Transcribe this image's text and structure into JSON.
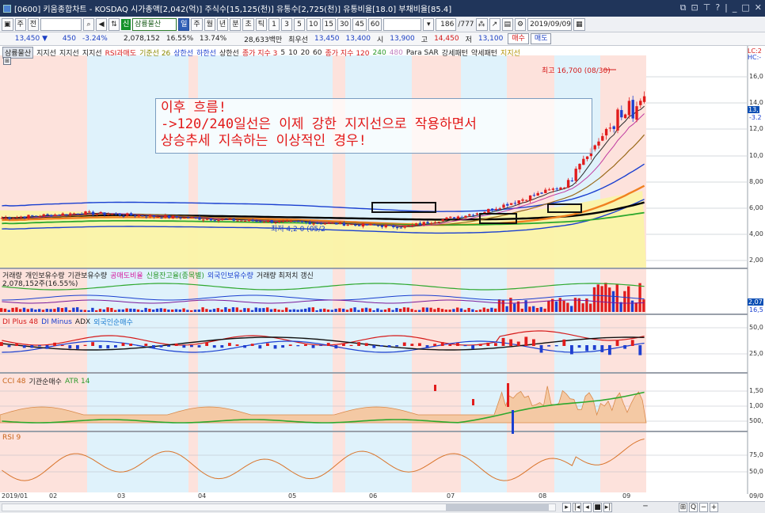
{
  "window": {
    "title": "[0600] 키움종합차트 - KOSDAQ 시가총액[2,042(억)] 주식수[15,125(천)] 유통수[2,725(천)] 유통비율[18.0] 부채비율[85.4]",
    "controls": [
      "⧉",
      "⊡",
      "⊤",
      "?",
      "|",
      "_",
      "□",
      "✕"
    ]
  },
  "toolbar1": {
    "mode_label": "주",
    "whole_label": "전",
    "code_value": "",
    "stock_badge": "신",
    "stock_name": "삼륭물산",
    "periods": [
      "일",
      "주",
      "월",
      "년",
      "분",
      "초",
      "틱"
    ],
    "selected_period": "일",
    "minutes": [
      "1",
      "3",
      "5",
      "10",
      "15",
      "30",
      "45",
      "60"
    ],
    "count_value": "186",
    "count_total": "/777",
    "date_value": "2019/09/09"
  },
  "quote": {
    "price": "13,450 ▼",
    "change": "450",
    "change_pct": "-3.24%",
    "volume": "2,078,152",
    "vol_pct": "16.55%",
    "turnover_pct": "13.74%",
    "amount": "28,633백만",
    "label_best": "최우선",
    "best_ask": "13,450",
    "best_bid": "13,400",
    "open_label": "시",
    "open": "13,900",
    "high_label": "고",
    "high": "14,450",
    "low_label": "저",
    "low": "13,100",
    "buy_label": "매수",
    "sell_label": "매도"
  },
  "legends": {
    "price": [
      "삼륭물산",
      "지지선",
      "지지선",
      "지지선",
      "RSI과매도",
      "기준선 26",
      "상한선",
      "하한선",
      "상한선",
      "종가 지수 3",
      "5",
      "10",
      "20",
      "60",
      "종가 지수 120",
      "240",
      "480",
      "Para SAR",
      "강세패턴",
      "약세패턴",
      "지지선"
    ],
    "volume": [
      "거래량",
      "개인보유수량",
      "기관보유수량",
      "공매도비율",
      "신용잔고율(종목별)",
      "외국인보유수량",
      "거래량 최저치 갱신"
    ],
    "volume_value": "2,078,152주(16.55%)",
    "dmi": [
      "DI Plus 48",
      "DI Minus",
      "ADX",
      "외국인순매수"
    ],
    "cci": [
      "CCI 48",
      "기관순매수",
      "ATR 14"
    ],
    "rsi": [
      "RSI 9"
    ]
  },
  "annotation": {
    "line1": "이후 흐름!",
    "line2": "->120/240일선은 이제 강한 지지선으로 작용하면서",
    "line3": "상승추세 지속하는 이상적인 경우!"
  },
  "price_marks": {
    "high_note": "최고 16,700 (08/30)",
    "low_note": "최저 4,2 0 (05/2",
    "right_top": "LC:2",
    "right_hc": "HC:-",
    "right_price": "13,",
    "right_pct": "-3.2"
  },
  "price_axis": [
    "16,0",
    "14,0",
    "12,0",
    "10,0",
    "8,00",
    "6,00",
    "4,00",
    "2,00"
  ],
  "volume_axis": [
    "2,07",
    "16,5"
  ],
  "dmi_axis": [
    "50,0",
    "25,0"
  ],
  "cci_axis": [
    "1,50",
    "1,00",
    "500,"
  ],
  "rsi_axis": [
    "75,0",
    "50,0"
  ],
  "x_axis": [
    "2019/01",
    "02",
    "03",
    "04",
    "05",
    "06",
    "07",
    "08",
    "09",
    "09/0"
  ],
  "nav_buttons": [
    "▸",
    "|◂",
    "◂",
    "■",
    "▸|",
    "─",
    "⊞",
    "Q",
    "−",
    "+"
  ],
  "colors": {
    "title_bg": "#20355a",
    "band_pink": "#fde2dc",
    "band_blue": "#dff2fb",
    "cloud_yellow": "#fbf3a6",
    "candle_up": "#e11c1c",
    "candle_down": "#1f3fd0",
    "annotation_text": "#e21818"
  },
  "chart_data": {
    "type": "line",
    "title": "삼륭물산",
    "x": [
      "2019/01",
      "02",
      "03",
      "04",
      "05",
      "06",
      "07",
      "08",
      "09"
    ],
    "series": [
      {
        "name": "삼륭물산",
        "values": [
          5300,
          5700,
          5400,
          5100,
          4900,
          4600,
          5800,
          7800,
          13450
        ]
      },
      {
        "name": "종가 지수 120",
        "values": [
          5200,
          5300,
          5250,
          5100,
          5000,
          4900,
          5300,
          6100,
          7900
        ]
      },
      {
        "name": "240",
        "values": [
          5000,
          5050,
          5000,
          4950,
          4900,
          4850,
          5050,
          5500,
          6200
        ]
      }
    ],
    "ylim": [
      2000,
      16700
    ],
    "high": 16700
  }
}
